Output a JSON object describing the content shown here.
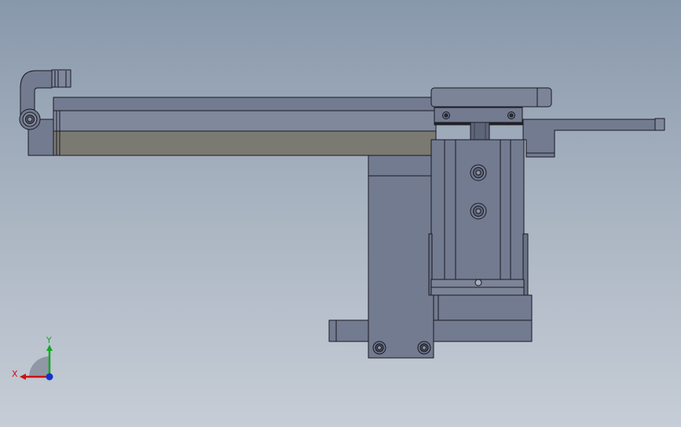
{
  "viewport": {
    "background_top": "#8898ab",
    "background_bottom": "#c6cdd6"
  },
  "model": {
    "part_fill": "#737b90",
    "part_fill_light": "#80889c",
    "part_fill_dark": "#656c80",
    "rail_fill": "#7a7a72",
    "edge_color": "#1a1a22"
  },
  "triad": {
    "x_label": "X",
    "y_label": "Y",
    "x_color": "#cc1111",
    "y_color": "#11aa22",
    "z_color": "#1133cc"
  }
}
